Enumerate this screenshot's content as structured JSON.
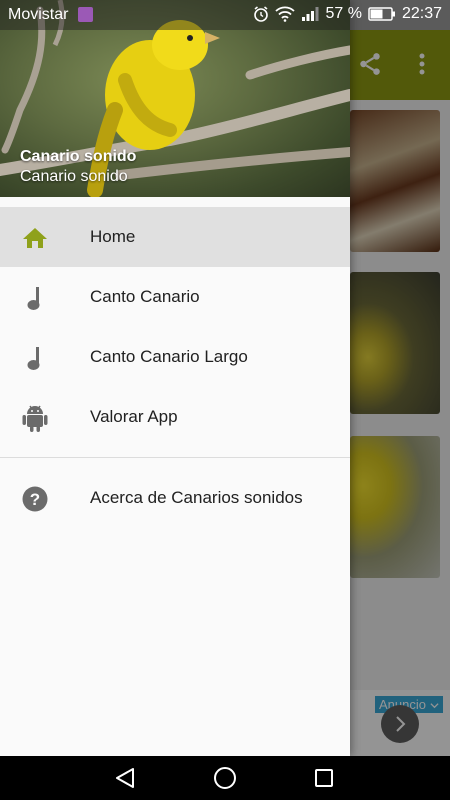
{
  "status_bar": {
    "carrier": "Movistar",
    "battery": "57 %",
    "time": "22:37"
  },
  "drawer": {
    "header": {
      "title": "Canario sonido",
      "subtitle": "Canario sonido"
    },
    "items": [
      {
        "label": "Home",
        "icon": "home-icon",
        "active": true
      },
      {
        "label": "Canto Canario",
        "icon": "music-note-icon",
        "active": false
      },
      {
        "label": "Canto Canario Largo",
        "icon": "music-note-icon",
        "active": false
      },
      {
        "label": "Valorar App",
        "icon": "android-icon",
        "active": false
      }
    ],
    "secondary_items": [
      {
        "label": "Acerca de Canarios sonidos",
        "icon": "help-icon"
      }
    ]
  },
  "ad": {
    "label": "Anuncio"
  },
  "colors": {
    "toolbar": "#8d9a12",
    "active_icon": "#8fa11b",
    "inactive_icon": "#6b6b6b",
    "active_row": "#e0e0e0"
  }
}
